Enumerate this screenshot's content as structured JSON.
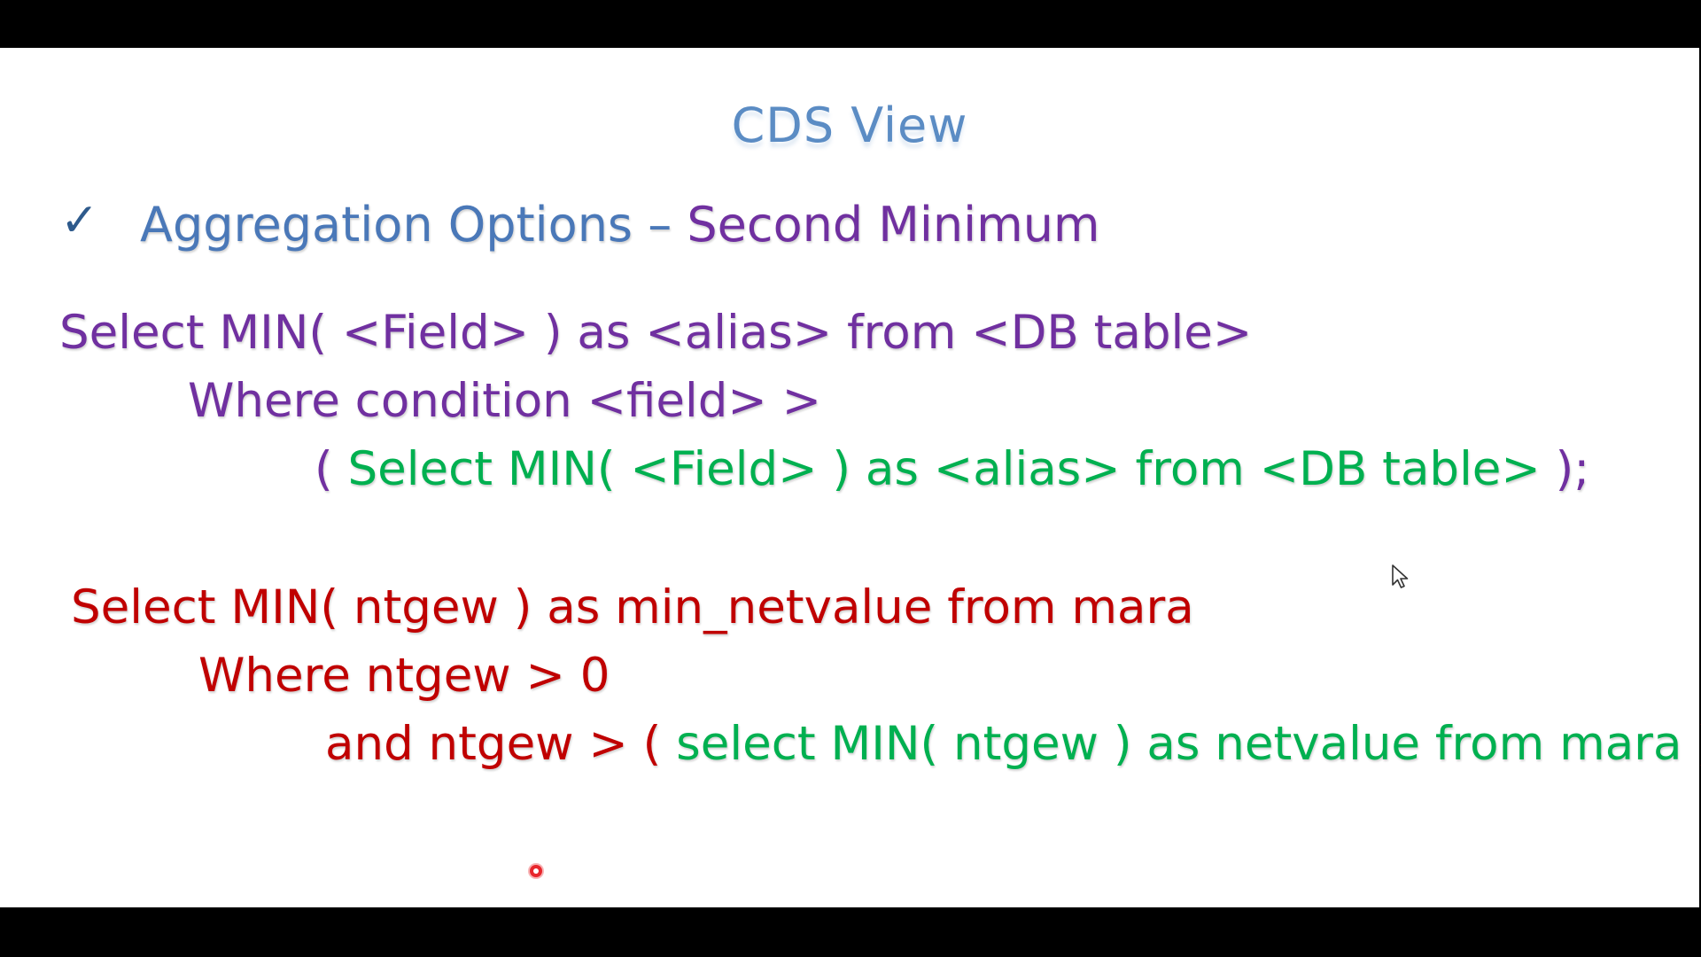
{
  "slide": {
    "title": "CDS View",
    "heading": {
      "part1": "Aggregation Options – ",
      "part2": "Second Minimum",
      "check_icon": "checkmark-icon"
    },
    "syntax": {
      "line1": "Select MIN( <Field> ) as <alias> from <DB table>",
      "line2": "Where condition <field> >",
      "line3_open": "( ",
      "line3_inner": "Select MIN( <Field> ) as <alias> from <DB table>",
      "line3_close": " );"
    },
    "example": {
      "line1": "Select MIN( ntgew ) as min_netvalue from mara",
      "line2": "Where ntgew > 0",
      "line3_outer": "and ntgew > ( ",
      "line3_inner": "select MIN( ntgew ) as netvalue from mara",
      "line3_close": " );"
    },
    "colors": {
      "title": "#5b8cc4",
      "heading_blue": "#4a78b8",
      "purple": "#7030a0",
      "green": "#00b050",
      "red": "#c00000",
      "laser_pointer": "#e8262c"
    }
  }
}
